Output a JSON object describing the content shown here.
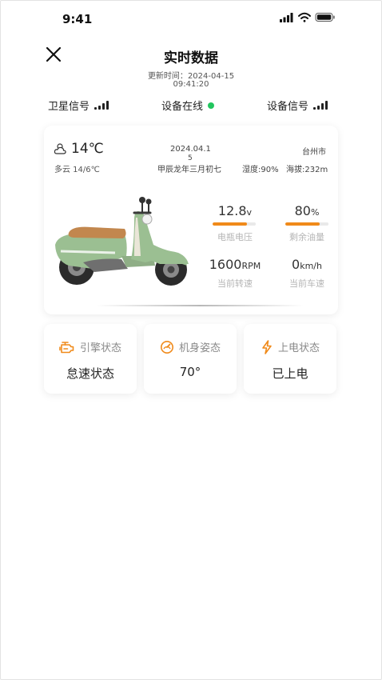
{
  "status_bar": {
    "time": "9:41"
  },
  "header": {
    "title": "实时数据",
    "update_label": "更新时间：",
    "update_date": "2024-04-15",
    "update_time": "09:41:20"
  },
  "signals": {
    "satellite_label": "卫星信号",
    "device_online_label": "设备在线",
    "device_signal_label": "设备信号"
  },
  "weather": {
    "temperature": "14℃",
    "condition": "多云 14/6℃",
    "date": "2024.04.1",
    "date_overlap": "5",
    "lunar": "甲辰龙年三月初七",
    "humidity": "湿度:90%",
    "altitude": "海拔:232m",
    "city": "台州市"
  },
  "metrics": {
    "battery": {
      "value": "12.8",
      "unit": "v",
      "label": "电瓶电压",
      "level": 0.8
    },
    "fuel": {
      "value": "80",
      "unit": "%",
      "label": "剩余油量",
      "level": 0.8
    },
    "rpm": {
      "value": "1600",
      "unit": "RPM",
      "label": "当前转速"
    },
    "speed": {
      "value": "0",
      "unit": "km/h",
      "label": "当前车速"
    }
  },
  "status_cards": [
    {
      "label": "引擎状态",
      "value": "怠速状态",
      "icon": "engine-icon"
    },
    {
      "label": "机身姿态",
      "value": "70°",
      "icon": "gauge-icon"
    },
    {
      "label": "上电状态",
      "value": "已上电",
      "icon": "lightning-icon"
    }
  ],
  "colors": {
    "accent": "#f08a1a",
    "online": "#22c55e",
    "scooter_body": "#9bbf92"
  }
}
